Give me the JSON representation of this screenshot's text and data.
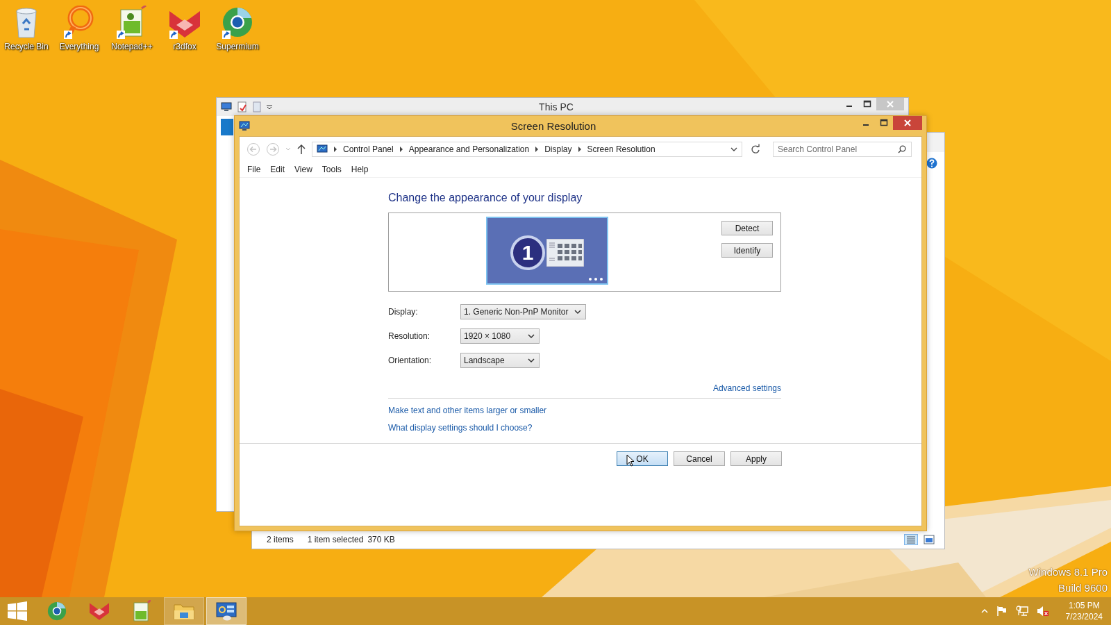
{
  "desktop_icons": [
    {
      "label": "Recycle Bin",
      "kind": "recycle-bin",
      "shortcut": false
    },
    {
      "label": "Everything",
      "kind": "everything",
      "shortcut": true
    },
    {
      "label": "Notepad++",
      "kind": "notepad",
      "shortcut": true
    },
    {
      "label": "r3dfox",
      "kind": "r3dfox",
      "shortcut": true
    },
    {
      "label": "Supermium",
      "kind": "supermium",
      "shortcut": true
    }
  ],
  "this_pc_window": {
    "title": "This PC"
  },
  "explorer_status_bar": {
    "items": "2 items",
    "selection": "1 item selected",
    "size": "370 KB"
  },
  "screen_resolution_window": {
    "title": "Screen Resolution",
    "breadcrumb": [
      "Control Panel",
      "Appearance and Personalization",
      "Display",
      "Screen Resolution"
    ],
    "search": {
      "placeholder": "Search Control Panel"
    },
    "menu": [
      "File",
      "Edit",
      "View",
      "Tools",
      "Help"
    ],
    "heading": "Change the appearance of your display",
    "monitor_number": "1",
    "side_buttons": [
      "Detect",
      "Identify"
    ],
    "fields": [
      {
        "label": "Display:",
        "value": "1. Generic Non-PnP Monitor"
      },
      {
        "label": "Resolution:",
        "value": "1920 × 1080"
      },
      {
        "label": "Orientation:",
        "value": "Landscape"
      }
    ],
    "advanced_link": "Advanced settings",
    "links": [
      "Make text and other items larger or smaller",
      "What display settings should I choose?"
    ],
    "buttons": [
      {
        "label": "OK",
        "default": true
      },
      {
        "label": "Cancel",
        "default": false
      },
      {
        "label": "Apply",
        "default": false
      }
    ]
  },
  "os_watermark": [
    "Windows 8.1 Pro",
    "Build 9600"
  ],
  "taskbar": {
    "apps": [
      {
        "kind": "start",
        "running": false,
        "selected": false
      },
      {
        "kind": "supermium",
        "running": false,
        "selected": false
      },
      {
        "kind": "r3dfox",
        "running": false,
        "selected": false
      },
      {
        "kind": "notepad",
        "running": false,
        "selected": false
      },
      {
        "kind": "explorer",
        "running": true,
        "selected": false
      },
      {
        "kind": "control-panel",
        "running": true,
        "selected": true
      }
    ],
    "clock": {
      "time": "1:05 PM",
      "date": "7/23/2024"
    }
  }
}
